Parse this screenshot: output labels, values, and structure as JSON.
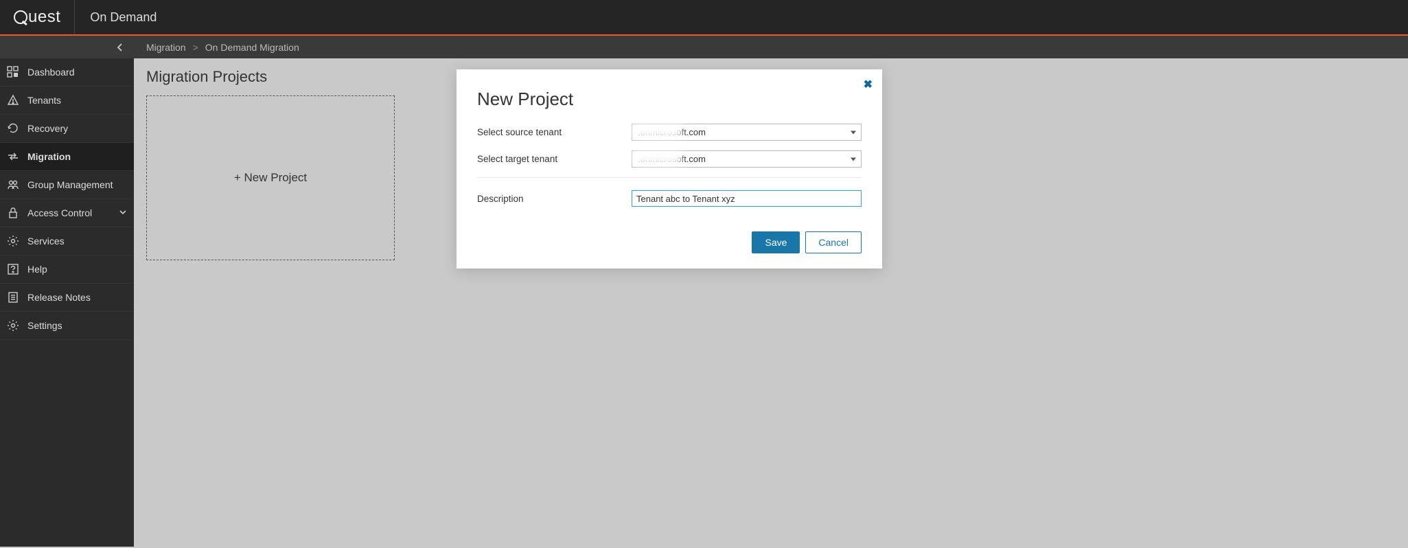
{
  "brand": {
    "logo_text": "uest",
    "product": "On Demand"
  },
  "sidebar": {
    "items": [
      {
        "label": "Dashboard"
      },
      {
        "label": "Tenants"
      },
      {
        "label": "Recovery"
      },
      {
        "label": "Migration"
      },
      {
        "label": "Group Management"
      },
      {
        "label": "Access Control"
      },
      {
        "label": "Services"
      },
      {
        "label": "Help"
      },
      {
        "label": "Release Notes"
      },
      {
        "label": "Settings"
      }
    ]
  },
  "breadcrumb": {
    "level1": "Migration",
    "level2": "On Demand Migration"
  },
  "page": {
    "title": "Migration Projects",
    "tile_label": "+ New Project"
  },
  "modal": {
    "title": "New Project",
    "source_label": "Select source tenant",
    "source_value": ".onmicrosoft.com",
    "target_label": "Select target tenant",
    "target_value": ".onmicrosoft.com",
    "description_label": "Description",
    "description_value": "Tenant abc to Tenant xyz",
    "save": "Save",
    "cancel": "Cancel"
  }
}
